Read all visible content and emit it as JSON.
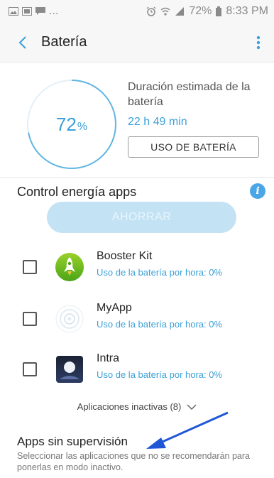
{
  "status_bar": {
    "left_dots": "...",
    "battery_percent": "72%",
    "time": "8:33 PM"
  },
  "app_bar": {
    "title": "Batería"
  },
  "battery": {
    "percent_value": "72",
    "percent_symbol": "%",
    "level": 0.72,
    "estimated_label": "Duración estimada de la batería",
    "estimated_value": "22 h 49 min",
    "usage_button": "USO DE BATERÍA"
  },
  "power_control": {
    "title": "Control energía apps",
    "save_button": "AHORRAR",
    "apps": [
      {
        "name": "Booster Kit",
        "usage": "Uso de la batería por hora: 0%",
        "icon": "booster-kit-icon"
      },
      {
        "name": "MyApp",
        "usage": "Uso de la batería por hora: 0%",
        "icon": "myapp-icon"
      },
      {
        "name": "Intra",
        "usage": "Uso de la batería por hora: 0%",
        "icon": "intra-icon"
      }
    ],
    "inactive_apps": "Aplicaciones inactivas (8)"
  },
  "unsupervised": {
    "title": "Apps sin supervisión",
    "description": "Seleccionar las aplicaciones que no se recomendarán para ponerlas en modo inactivo."
  },
  "colors": {
    "accent": "#3ca0d8",
    "save_button_bg": "#c3e2f4",
    "arrow": "#1f57d6",
    "info": "#4aa6e6"
  }
}
